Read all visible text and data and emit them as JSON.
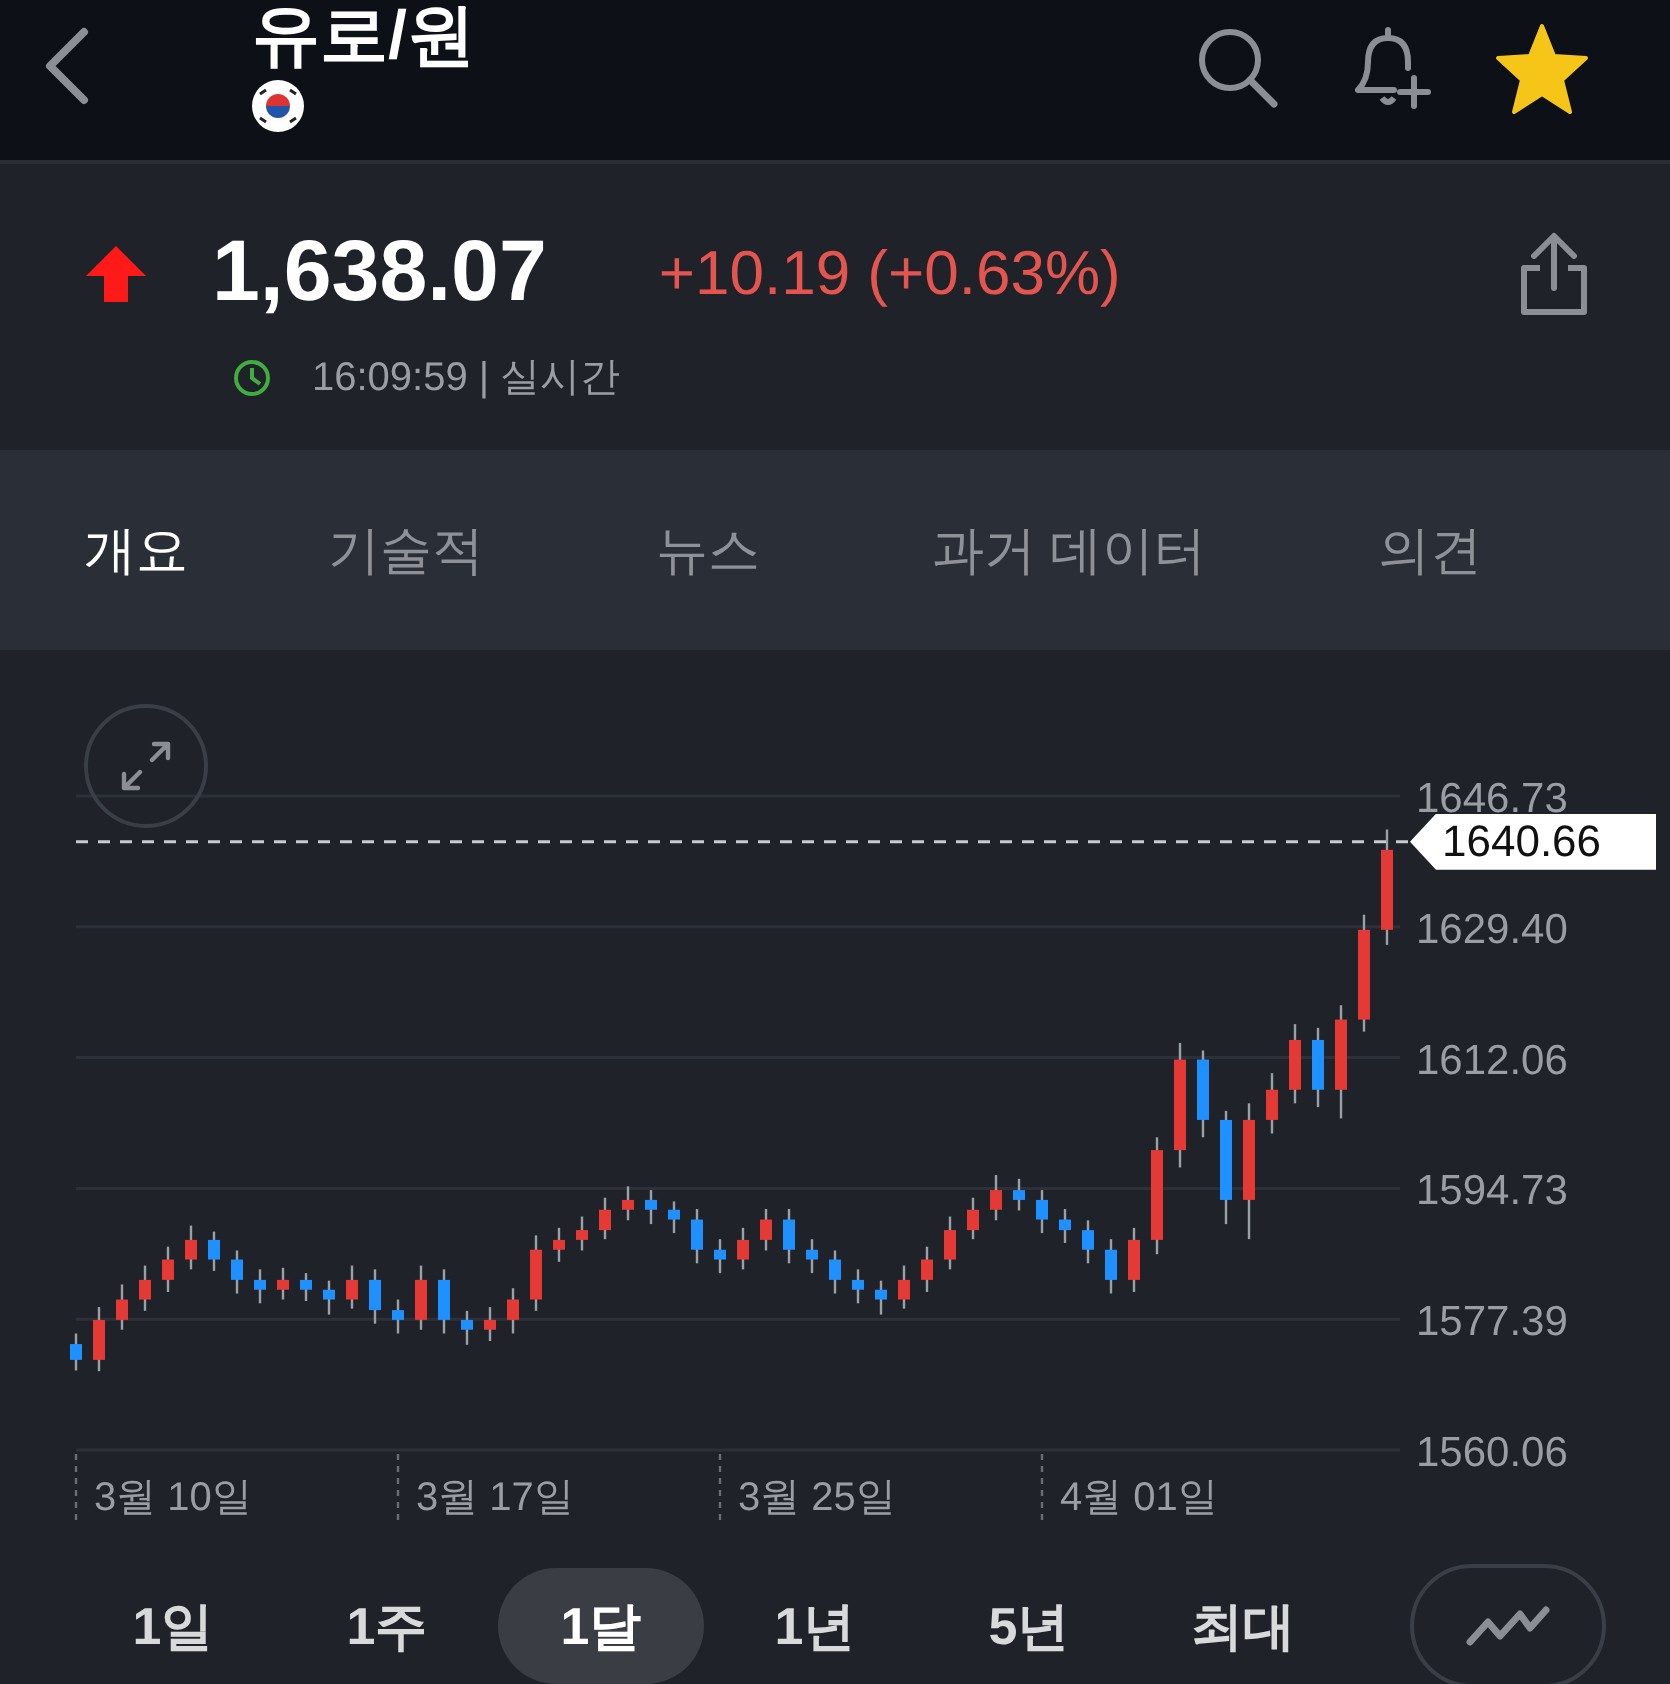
{
  "header": {
    "title": "유로/원"
  },
  "quote": {
    "price": "1,638.07",
    "change": "+10.19 (+0.63%)",
    "time": "16:09:59 | 실시간"
  },
  "tabs": [
    {
      "label": "개요",
      "selected": true
    },
    {
      "label": "기술적",
      "selected": false
    },
    {
      "label": "뉴스",
      "selected": false
    },
    {
      "label": "과거 데이터",
      "selected": false
    },
    {
      "label": "의견",
      "selected": false
    }
  ],
  "chart": {
    "chart_data": {
      "type": "candlestick",
      "grid": true,
      "ref_lines": [
        {
          "axis": "y",
          "value": 1640.66,
          "label": "1640.66"
        }
      ],
      "ylim": [
        1560.06,
        1646.73
      ],
      "yticks": [
        {
          "value": 1646.73,
          "label": "1646.73"
        },
        {
          "value": 1629.4,
          "label": "1629.40"
        },
        {
          "value": 1612.06,
          "label": "1612.06"
        },
        {
          "value": 1594.73,
          "label": "1594.73"
        },
        {
          "value": 1577.39,
          "label": "1577.39"
        },
        {
          "value": 1560.06,
          "label": "1560.06"
        }
      ],
      "categories": [
        null,
        null,
        null,
        null,
        "3월 10일",
        null,
        null,
        null,
        null,
        null,
        null,
        null,
        null,
        null,
        null,
        null,
        null,
        null,
        "3월 17일",
        null,
        null,
        null,
        null,
        null,
        null,
        null,
        null,
        null,
        null,
        null,
        null,
        null,
        "3월 25일",
        null,
        null,
        null,
        null,
        null,
        null,
        null,
        null,
        null,
        null,
        null,
        null,
        null,
        "4월 01일",
        null,
        null,
        null,
        null,
        null,
        null,
        null,
        null,
        null,
        null,
        null
      ],
      "ohlc": [
        [
          1574.1,
          1575.5,
          1570.6,
          1572.0
        ],
        [
          1572.0,
          1579.0,
          1570.5,
          1577.3
        ],
        [
          1577.3,
          1582.0,
          1576.0,
          1580.0
        ],
        [
          1580.0,
          1584.5,
          1578.5,
          1582.6
        ],
        [
          1582.6,
          1587.0,
          1581.0,
          1585.3
        ],
        [
          1585.3,
          1589.8,
          1584.0,
          1587.9
        ],
        [
          1587.9,
          1589.0,
          1583.8,
          1585.3
        ],
        [
          1585.3,
          1586.5,
          1580.8,
          1582.6
        ],
        [
          1582.6,
          1584.0,
          1579.5,
          1581.3
        ],
        [
          1581.3,
          1584.2,
          1580.0,
          1582.6
        ],
        [
          1582.6,
          1583.5,
          1579.8,
          1581.3
        ],
        [
          1581.3,
          1582.5,
          1578.0,
          1580.0
        ],
        [
          1580.0,
          1584.5,
          1578.8,
          1582.6
        ],
        [
          1582.6,
          1584.0,
          1576.8,
          1578.6
        ],
        [
          1578.6,
          1580.0,
          1575.5,
          1577.3
        ],
        [
          1577.3,
          1584.5,
          1576.0,
          1582.6
        ],
        [
          1582.6,
          1584.0,
          1575.5,
          1577.3
        ],
        [
          1577.3,
          1578.5,
          1574.0,
          1576.0
        ],
        [
          1576.0,
          1579.0,
          1574.5,
          1577.3
        ],
        [
          1577.3,
          1581.5,
          1575.5,
          1580.0
        ],
        [
          1580.0,
          1588.5,
          1578.5,
          1586.6
        ],
        [
          1586.6,
          1589.5,
          1585.0,
          1587.9
        ],
        [
          1587.9,
          1591.0,
          1586.5,
          1589.2
        ],
        [
          1589.2,
          1593.5,
          1588.0,
          1591.9
        ],
        [
          1591.9,
          1595.0,
          1590.5,
          1593.2
        ],
        [
          1593.2,
          1594.5,
          1590.0,
          1591.9
        ],
        [
          1591.9,
          1593.0,
          1588.8,
          1590.6
        ],
        [
          1590.6,
          1592.0,
          1584.8,
          1586.6
        ],
        [
          1586.6,
          1588.0,
          1583.5,
          1585.3
        ],
        [
          1585.3,
          1589.5,
          1584.0,
          1587.9
        ],
        [
          1587.9,
          1592.0,
          1586.5,
          1590.6
        ],
        [
          1590.6,
          1592.0,
          1584.8,
          1586.6
        ],
        [
          1586.6,
          1588.0,
          1583.5,
          1585.3
        ],
        [
          1585.3,
          1586.5,
          1580.8,
          1582.6
        ],
        [
          1582.6,
          1584.0,
          1579.5,
          1581.3
        ],
        [
          1581.3,
          1582.5,
          1578.0,
          1580.0
        ],
        [
          1580.0,
          1584.5,
          1578.8,
          1582.6
        ],
        [
          1582.6,
          1587.0,
          1581.0,
          1585.3
        ],
        [
          1585.3,
          1591.0,
          1584.0,
          1589.2
        ],
        [
          1589.2,
          1593.5,
          1588.0,
          1591.9
        ],
        [
          1591.9,
          1596.5,
          1590.5,
          1594.5
        ],
        [
          1594.5,
          1596.0,
          1591.8,
          1593.2
        ],
        [
          1593.2,
          1594.5,
          1588.8,
          1590.6
        ],
        [
          1590.6,
          1592.0,
          1587.5,
          1589.2
        ],
        [
          1589.2,
          1590.5,
          1584.8,
          1586.6
        ],
        [
          1586.6,
          1588.0,
          1580.8,
          1582.6
        ],
        [
          1582.6,
          1589.5,
          1581.0,
          1587.9
        ],
        [
          1587.9,
          1601.5,
          1586.0,
          1599.8
        ],
        [
          1599.8,
          1614.0,
          1597.5,
          1611.8
        ],
        [
          1611.8,
          1613.0,
          1601.5,
          1603.8
        ],
        [
          1603.8,
          1605.0,
          1590.0,
          1593.2
        ],
        [
          1593.2,
          1606.0,
          1588.0,
          1603.8
        ],
        [
          1603.8,
          1610.0,
          1602.0,
          1607.8
        ],
        [
          1607.8,
          1616.5,
          1606.0,
          1614.4
        ],
        [
          1614.4,
          1616.0,
          1605.5,
          1607.8
        ],
        [
          1607.8,
          1619.0,
          1604.0,
          1617.1
        ],
        [
          1617.1,
          1631.0,
          1615.5,
          1629.0
        ],
        [
          1629.0,
          1642.3,
          1627.0,
          1639.6
        ]
      ]
    }
  },
  "ranges": [
    {
      "label": "1일",
      "selected": false
    },
    {
      "label": "1주",
      "selected": false
    },
    {
      "label": "1달",
      "selected": true
    },
    {
      "label": "1년",
      "selected": false
    },
    {
      "label": "5년",
      "selected": false
    },
    {
      "label": "최대",
      "selected": false
    }
  ]
}
